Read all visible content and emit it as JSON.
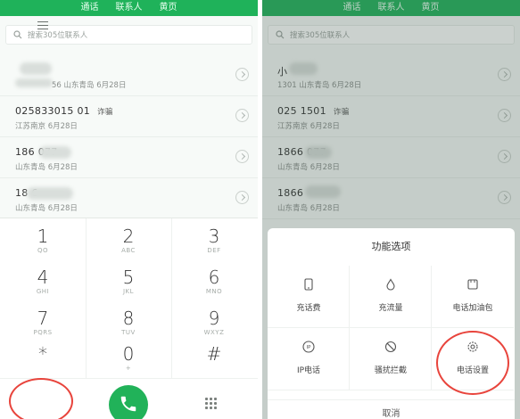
{
  "tabs": [
    "通话",
    "联系人",
    "黄页"
  ],
  "search": {
    "placeholder": "搜索305位联系人"
  },
  "calls_left": [
    {
      "number": "",
      "tag": "",
      "meta": "56  山东青岛  6月28日"
    },
    {
      "number": "025833015 01",
      "tag": "诈骗",
      "meta": "江苏南京  6月28日"
    },
    {
      "number": "186     077",
      "tag": "",
      "meta": "山东青岛  6月28日"
    },
    {
      "number": "18       6",
      "tag": "",
      "meta": "山东青岛  6月28日"
    }
  ],
  "calls_right": [
    {
      "number": "小",
      "tag": "",
      "meta": "1301   山东青岛  6月28日"
    },
    {
      "number": "025     1501",
      "tag": "诈骗",
      "meta": "江苏南京  6月28日"
    },
    {
      "number": "1866     077",
      "tag": "",
      "meta": "山东青岛  6月28日"
    },
    {
      "number": "1866     ",
      "tag": "",
      "meta": "山东青岛  6月28日"
    }
  ],
  "keys": [
    {
      "d": "1",
      "l": "QO"
    },
    {
      "d": "2",
      "l": "ABC"
    },
    {
      "d": "3",
      "l": "DEF"
    },
    {
      "d": "4",
      "l": "GHI"
    },
    {
      "d": "5",
      "l": "JKL"
    },
    {
      "d": "6",
      "l": "MNO"
    },
    {
      "d": "7",
      "l": "PQRS"
    },
    {
      "d": "8",
      "l": "TUV"
    },
    {
      "d": "9",
      "l": "WXYZ"
    },
    {
      "d": "*",
      "l": ""
    },
    {
      "d": "0",
      "l": "+"
    },
    {
      "d": "#",
      "l": ""
    }
  ],
  "sheet": {
    "title": "功能选项",
    "options": [
      {
        "label": "充话费",
        "icon": "phone-card-icon"
      },
      {
        "label": "充流量",
        "icon": "drop-icon"
      },
      {
        "label": "电话加油包",
        "icon": "package-icon"
      },
      {
        "label": "IP电话",
        "icon": "ip-icon"
      },
      {
        "label": "骚扰拦截",
        "icon": "block-icon"
      },
      {
        "label": "电话设置",
        "icon": "gear-icon"
      }
    ],
    "cancel": "取消"
  },
  "colors": {
    "accent": "#1fb25a",
    "highlight": "#e8443c"
  }
}
